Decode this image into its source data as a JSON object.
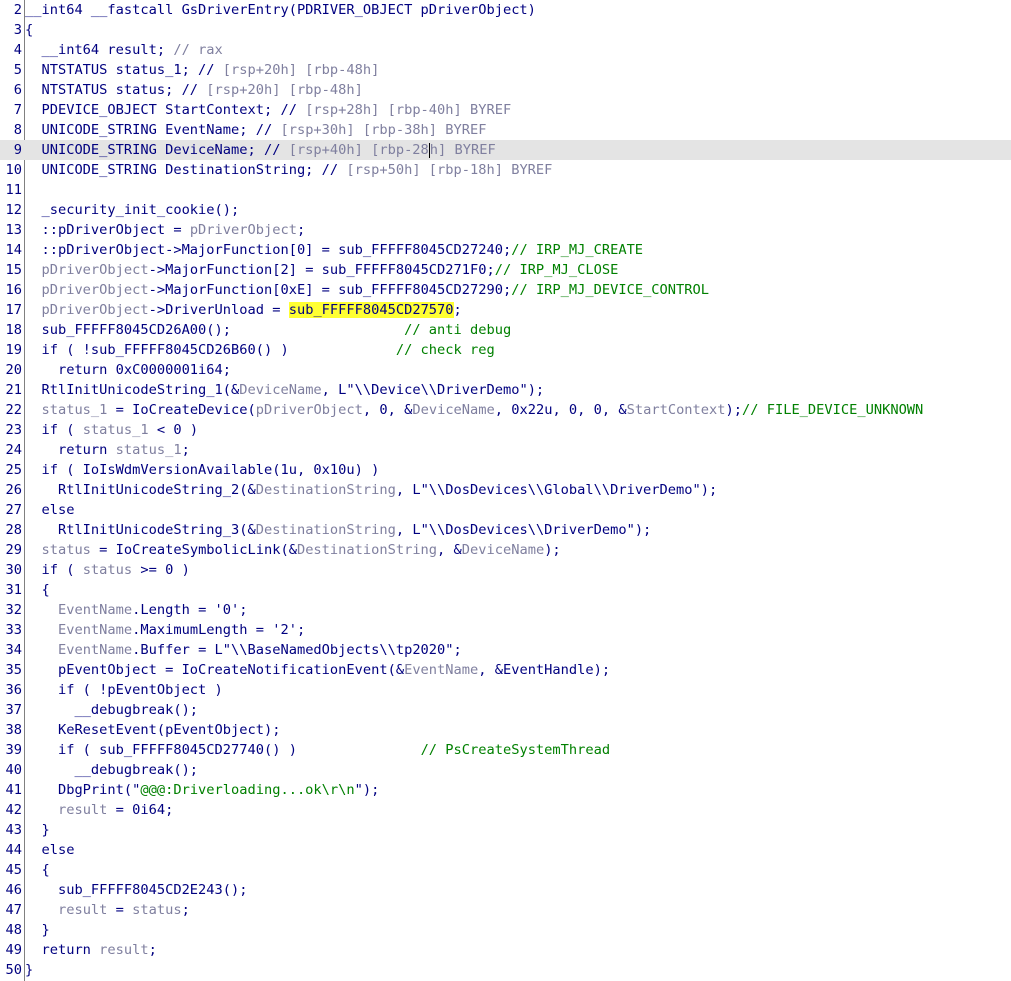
{
  "lines": [
    {
      "n": "2",
      "seg": [
        {
          "t": "__int64 __fastcall GsDriverEntry(PDRIVER_OBJECT pDriverObject)",
          "c": "k"
        }
      ]
    },
    {
      "n": "3",
      "seg": [
        {
          "t": "{",
          "c": "k"
        }
      ]
    },
    {
      "n": "4",
      "seg": [
        {
          "t": "  __int64 result; ",
          "c": "k"
        },
        {
          "t": "// rax",
          "c": "v"
        }
      ]
    },
    {
      "n": "5",
      "seg": [
        {
          "t": "  NTSTATUS status_1; // ",
          "c": "k"
        },
        {
          "t": "[rsp+20h] [rbp-48h]",
          "c": "v"
        }
      ]
    },
    {
      "n": "6",
      "seg": [
        {
          "t": "  NTSTATUS status; // ",
          "c": "k"
        },
        {
          "t": "[rsp+20h] [rbp-48h]",
          "c": "v"
        }
      ]
    },
    {
      "n": "7",
      "seg": [
        {
          "t": "  PDEVICE_OBJECT StartContext; // ",
          "c": "k"
        },
        {
          "t": "[rsp+28h] [rbp-40h] BYREF",
          "c": "v"
        }
      ]
    },
    {
      "n": "8",
      "seg": [
        {
          "t": "  UNICODE_STRING EventName; // ",
          "c": "k"
        },
        {
          "t": "[rsp+30h] [rbp-38h] BYREF",
          "c": "v"
        }
      ]
    },
    {
      "n": "9",
      "current": true,
      "seg": [
        {
          "t": "  UNICODE_STRING DeviceName; // ",
          "c": "k"
        },
        {
          "t": "[rsp+40h] [rbp-28",
          "c": "v"
        },
        {
          "caret": true
        },
        {
          "t": "h] BYREF",
          "c": "v"
        }
      ]
    },
    {
      "n": "10",
      "seg": [
        {
          "t": "  UNICODE_STRING DestinationString; // ",
          "c": "k"
        },
        {
          "t": "[rsp+50h] [rbp-18h] BYREF",
          "c": "v"
        }
      ]
    },
    {
      "n": "11",
      "seg": []
    },
    {
      "n": "12",
      "seg": [
        {
          "t": "  _security_init_cookie();",
          "c": "k"
        }
      ]
    },
    {
      "n": "13",
      "seg": [
        {
          "t": "  ::pDriverObject = ",
          "c": "k"
        },
        {
          "t": "pDriverObject",
          "c": "v"
        },
        {
          "t": ";",
          "c": "k"
        }
      ]
    },
    {
      "n": "14",
      "seg": [
        {
          "t": "  ::pDriverObject->MajorFunction[0] = sub_FFFFF8045CD27240;",
          "c": "k"
        },
        {
          "t": "// IRP_MJ_CREATE",
          "c": "c"
        }
      ]
    },
    {
      "n": "15",
      "seg": [
        {
          "t": "  ",
          "c": "k"
        },
        {
          "t": "pDriverObject",
          "c": "v"
        },
        {
          "t": "->MajorFunction[2] = sub_FFFFF8045CD271F0;",
          "c": "k"
        },
        {
          "t": "// IRP_MJ_CLOSE",
          "c": "c"
        }
      ]
    },
    {
      "n": "16",
      "seg": [
        {
          "t": "  ",
          "c": "k"
        },
        {
          "t": "pDriverObject",
          "c": "v"
        },
        {
          "t": "->MajorFunction[0xE] = sub_FFFFF8045CD27290;",
          "c": "k"
        },
        {
          "t": "// IRP_MJ_DEVICE_CONTROL",
          "c": "c"
        }
      ]
    },
    {
      "n": "17",
      "seg": [
        {
          "t": "  ",
          "c": "k"
        },
        {
          "t": "pDriverObject",
          "c": "v"
        },
        {
          "t": "->DriverUnload = ",
          "c": "k"
        },
        {
          "t": "sub_FFFFF8045CD27570",
          "c": "k",
          "hl": true
        },
        {
          "t": ";",
          "c": "k"
        }
      ]
    },
    {
      "n": "18",
      "seg": [
        {
          "t": "  sub_FFFFF8045CD26A00();                     ",
          "c": "k"
        },
        {
          "t": "// anti debug",
          "c": "c"
        }
      ]
    },
    {
      "n": "19",
      "seg": [
        {
          "t": "  if ( !sub_FFFFF8045CD26B60() )             ",
          "c": "k"
        },
        {
          "t": "// check reg",
          "c": "c"
        }
      ]
    },
    {
      "n": "20",
      "seg": [
        {
          "t": "    return 0xC0000001i64;",
          "c": "k"
        }
      ]
    },
    {
      "n": "21",
      "seg": [
        {
          "t": "  RtlInitUnicodeString_1(&",
          "c": "k"
        },
        {
          "t": "DeviceName",
          "c": "v"
        },
        {
          "t": ", L\"",
          "c": "k"
        },
        {
          "t": "\\\\Device\\\\DriverDemo",
          "c": "k"
        },
        {
          "t": "\");",
          "c": "k"
        }
      ]
    },
    {
      "n": "22",
      "seg": [
        {
          "t": "  ",
          "c": "k"
        },
        {
          "t": "status_1",
          "c": "v"
        },
        {
          "t": " = IoCreateDevice(",
          "c": "k"
        },
        {
          "t": "pDriverObject",
          "c": "v"
        },
        {
          "t": ", 0, &",
          "c": "k"
        },
        {
          "t": "DeviceName",
          "c": "v"
        },
        {
          "t": ", 0x22u, 0, 0, &",
          "c": "k"
        },
        {
          "t": "StartContext",
          "c": "v"
        },
        {
          "t": ");",
          "c": "k"
        },
        {
          "t": "// FILE_DEVICE_UNKNOWN",
          "c": "c"
        }
      ]
    },
    {
      "n": "23",
      "seg": [
        {
          "t": "  if ( ",
          "c": "k"
        },
        {
          "t": "status_1",
          "c": "v"
        },
        {
          "t": " < 0 )",
          "c": "k"
        }
      ]
    },
    {
      "n": "24",
      "seg": [
        {
          "t": "    return ",
          "c": "k"
        },
        {
          "t": "status_1",
          "c": "v"
        },
        {
          "t": ";",
          "c": "k"
        }
      ]
    },
    {
      "n": "25",
      "seg": [
        {
          "t": "  if ( IoIsWdmVersionAvailable(1u, 0x10u) )",
          "c": "k"
        }
      ]
    },
    {
      "n": "26",
      "seg": [
        {
          "t": "    RtlInitUnicodeString_2(&",
          "c": "k"
        },
        {
          "t": "DestinationString",
          "c": "v"
        },
        {
          "t": ", L\"\\\\DosDevices\\\\Global\\\\DriverDemo\");",
          "c": "k"
        }
      ]
    },
    {
      "n": "27",
      "seg": [
        {
          "t": "  else",
          "c": "k"
        }
      ]
    },
    {
      "n": "28",
      "seg": [
        {
          "t": "    RtlInitUnicodeString_3(&",
          "c": "k"
        },
        {
          "t": "DestinationString",
          "c": "v"
        },
        {
          "t": ", L\"\\\\DosDevices\\\\DriverDemo\");",
          "c": "k"
        }
      ]
    },
    {
      "n": "29",
      "seg": [
        {
          "t": "  ",
          "c": "k"
        },
        {
          "t": "status",
          "c": "v"
        },
        {
          "t": " = IoCreateSymbolicLink(&",
          "c": "k"
        },
        {
          "t": "DestinationString",
          "c": "v"
        },
        {
          "t": ", &",
          "c": "k"
        },
        {
          "t": "DeviceName",
          "c": "v"
        },
        {
          "t": ");",
          "c": "k"
        }
      ]
    },
    {
      "n": "30",
      "seg": [
        {
          "t": "  if ( ",
          "c": "k"
        },
        {
          "t": "status",
          "c": "v"
        },
        {
          "t": " >= 0 )",
          "c": "k"
        }
      ]
    },
    {
      "n": "31",
      "seg": [
        {
          "t": "  {",
          "c": "k"
        }
      ]
    },
    {
      "n": "32",
      "seg": [
        {
          "t": "    ",
          "c": "k"
        },
        {
          "t": "EventName",
          "c": "v"
        },
        {
          "t": ".Length = '0';",
          "c": "k"
        }
      ]
    },
    {
      "n": "33",
      "seg": [
        {
          "t": "    ",
          "c": "k"
        },
        {
          "t": "EventName",
          "c": "v"
        },
        {
          "t": ".MaximumLength = '2';",
          "c": "k"
        }
      ]
    },
    {
      "n": "34",
      "seg": [
        {
          "t": "    ",
          "c": "k"
        },
        {
          "t": "EventName",
          "c": "v"
        },
        {
          "t": ".Buffer = L\"\\\\BaseNamedObjects\\\\tp2020\";",
          "c": "k"
        }
      ]
    },
    {
      "n": "35",
      "seg": [
        {
          "t": "    pEventObject = IoCreateNotificationEvent(&",
          "c": "k"
        },
        {
          "t": "EventName",
          "c": "v"
        },
        {
          "t": ", &EventHandle);",
          "c": "k"
        }
      ]
    },
    {
      "n": "36",
      "seg": [
        {
          "t": "    if ( !pEventObject )",
          "c": "k"
        }
      ]
    },
    {
      "n": "37",
      "seg": [
        {
          "t": "      __debugbreak();",
          "c": "k"
        }
      ]
    },
    {
      "n": "38",
      "seg": [
        {
          "t": "    KeResetEvent(pEventObject);",
          "c": "k"
        }
      ]
    },
    {
      "n": "39",
      "seg": [
        {
          "t": "    if ( sub_FFFFF8045CD27740() )               ",
          "c": "k"
        },
        {
          "t": "// PsCreateSystemThread",
          "c": "c"
        }
      ]
    },
    {
      "n": "40",
      "seg": [
        {
          "t": "      __debugbreak();",
          "c": "k"
        }
      ]
    },
    {
      "n": "41",
      "seg": [
        {
          "t": "    DbgPrint(\"",
          "c": "k"
        },
        {
          "t": "@@@:Driverloading...ok\\r\\n",
          "c": "c"
        },
        {
          "t": "\");",
          "c": "k"
        }
      ]
    },
    {
      "n": "42",
      "seg": [
        {
          "t": "    ",
          "c": "k"
        },
        {
          "t": "result",
          "c": "v"
        },
        {
          "t": " = 0i64;",
          "c": "k"
        }
      ]
    },
    {
      "n": "43",
      "seg": [
        {
          "t": "  }",
          "c": "k"
        }
      ]
    },
    {
      "n": "44",
      "seg": [
        {
          "t": "  else",
          "c": "k"
        }
      ]
    },
    {
      "n": "45",
      "seg": [
        {
          "t": "  {",
          "c": "k"
        }
      ]
    },
    {
      "n": "46",
      "seg": [
        {
          "t": "    sub_FFFFF8045CD2E243();",
          "c": "k"
        }
      ]
    },
    {
      "n": "47",
      "seg": [
        {
          "t": "    ",
          "c": "k"
        },
        {
          "t": "result",
          "c": "v"
        },
        {
          "t": " = ",
          "c": "k"
        },
        {
          "t": "status",
          "c": "v"
        },
        {
          "t": ";",
          "c": "k"
        }
      ]
    },
    {
      "n": "48",
      "seg": [
        {
          "t": "  }",
          "c": "k"
        }
      ]
    },
    {
      "n": "49",
      "seg": [
        {
          "t": "  return ",
          "c": "k"
        },
        {
          "t": "result",
          "c": "v"
        },
        {
          "t": ";",
          "c": "k"
        }
      ]
    },
    {
      "n": "50",
      "seg": [
        {
          "t": "}",
          "c": "k"
        }
      ]
    }
  ]
}
